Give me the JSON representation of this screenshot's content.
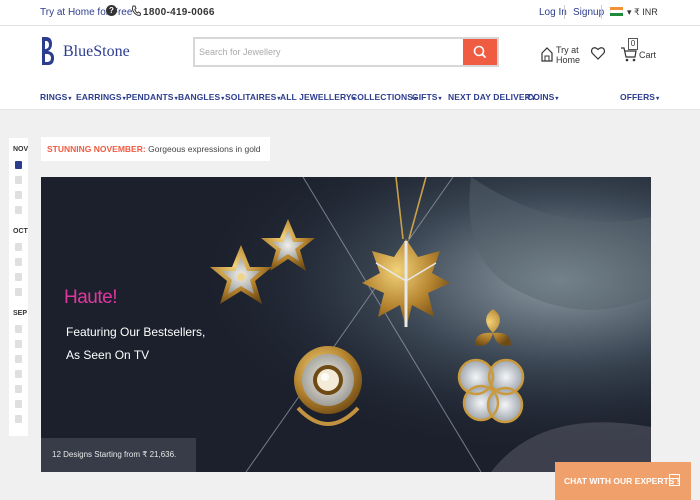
{
  "topbar": {
    "try_home": "Try at Home for Free",
    "help_glyph": "?",
    "phone": "1800-419-0066",
    "login": "Log In",
    "signup": "Signup",
    "currency": "▾ ₹ INR"
  },
  "header": {
    "logo": "BlueStone",
    "search_placeholder": "Search for Jewellery",
    "try_at_home": "Try at",
    "try_at_home_2": "Home",
    "cart_count": "0",
    "cart_label": "Cart"
  },
  "nav": [
    {
      "label": "RINGS"
    },
    {
      "label": "EARRINGS"
    },
    {
      "label": "PENDANTS"
    },
    {
      "label": "BANGLES"
    },
    {
      "label": "SOLITAIRES"
    },
    {
      "label": "ALL JEWELLERY"
    },
    {
      "label": "COLLECTIONS"
    },
    {
      "label": "GIFTS"
    },
    {
      "label": "NEXT DAY DELIVERY"
    },
    {
      "label": "COINS"
    },
    {
      "label": "OFFERS"
    }
  ],
  "timeline": {
    "months": [
      "NOV",
      "OCT",
      "SEP"
    ]
  },
  "ribbon": {
    "highlight": "STUNNING NOVEMBER:",
    "text": "Gorgeous expressions in gold"
  },
  "banner": {
    "headline": "Haute!",
    "line1": "Featuring Our Bestsellers,",
    "line2": "As Seen On TV",
    "designs": "12 Designs Starting from ₹ 21,636."
  },
  "chat": {
    "label": "CHAT WITH OUR EXPERTS !"
  },
  "colors": {
    "brand": "#2c3d8f",
    "accent": "#ef5c42",
    "headline": "#e0379f",
    "chat": "#f0a06b"
  },
  "icons": [
    "question-icon",
    "phone-icon",
    "india-flag-icon",
    "search-icon",
    "home-icon",
    "heart-icon",
    "cart-icon",
    "chat-icon"
  ]
}
